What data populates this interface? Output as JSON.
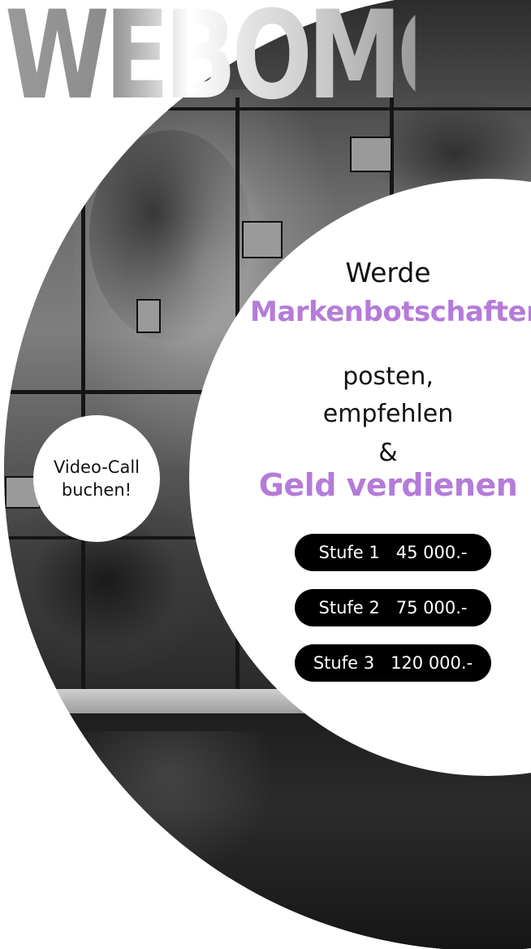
{
  "brand": {
    "title": "WEBOMO"
  },
  "headline": {
    "line1": "Werde",
    "line2": "Markenbotschafter",
    "line3": "posten,",
    "line4": "empfehlen",
    "line5": "&",
    "line6": "Geld verdienen"
  },
  "tiers": [
    {
      "level": "Stufe 1",
      "amount": "45 000.-"
    },
    {
      "level": "Stufe 2",
      "amount": "75 000.-"
    },
    {
      "level": "Stufe 3",
      "amount": "120 000.-"
    }
  ],
  "cta": {
    "line1": "Video-Call",
    "line2": "buchen!"
  },
  "colors": {
    "accent": "#b57bd9",
    "pill_background": "#000000",
    "pill_text": "#ffffff",
    "text": "#111111",
    "background": "#ffffff"
  }
}
